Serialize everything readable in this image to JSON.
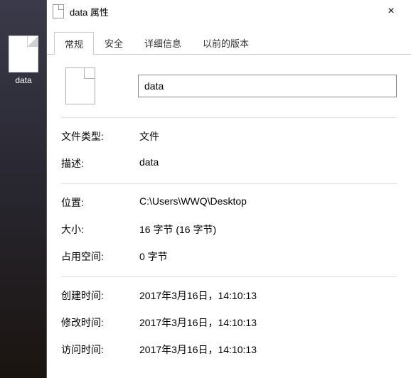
{
  "desktop": {
    "file_label": "data"
  },
  "dialog": {
    "title": "data 属性",
    "close": "×",
    "tabs": {
      "general": "常规",
      "security": "安全",
      "details": "详细信息",
      "previous": "以前的版本"
    },
    "filename": "data",
    "rows": {
      "type_label": "文件类型:",
      "type_value": "文件",
      "desc_label": "描述:",
      "desc_value": "data",
      "loc_label": "位置:",
      "loc_value": "C:\\Users\\WWQ\\Desktop",
      "size_label": "大小:",
      "size_value": "16 字节 (16 字节)",
      "disk_label": "占用空间:",
      "disk_value": "0 字节",
      "created_label": "创建时间:",
      "created_value": "2017年3月16日，14:10:13",
      "modified_label": "修改时间:",
      "modified_value": "2017年3月16日，14:10:13",
      "accessed_label": "访问时间:",
      "accessed_value": "2017年3月16日，14:10:13"
    }
  }
}
